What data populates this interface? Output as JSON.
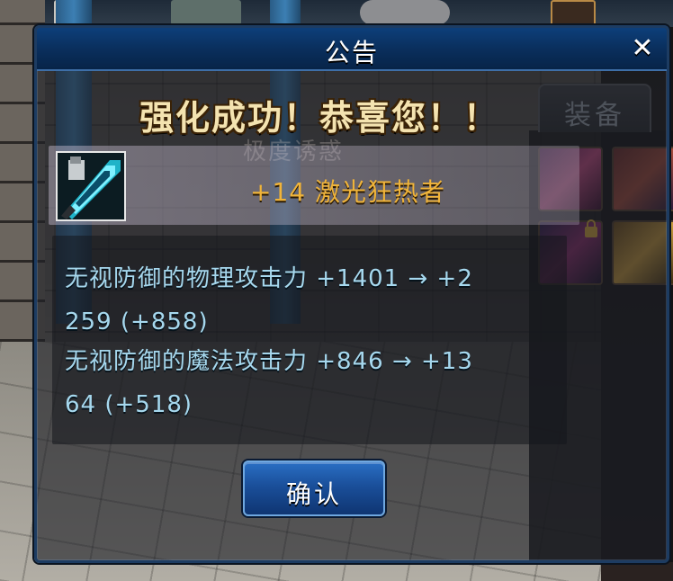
{
  "dialog": {
    "title": "公告",
    "close_icon": "close-icon",
    "close_glyph": "✕",
    "banner": "强化成功！恭喜您！！",
    "background_text": "极度诱惑",
    "item": {
      "icon": "weapon-icon",
      "name": "+14 激光狂热者"
    },
    "stats": [
      "无视防御的物理攻击力 +1401 → +2",
      "259 (+858)",
      "无视防御的魔法攻击力 +846 → +13",
      "64 (+518)"
    ],
    "confirm_label": "确认"
  },
  "side_panel": {
    "tab_label": "装备",
    "lock_icon": "lock-icon"
  },
  "colors": {
    "title_bar": "#0a2f5d",
    "item_name": "#f0b43a",
    "stat_text": "#a6d8ee",
    "banner_text": "#f4e3b0",
    "confirm_button": "#1a4f9a"
  }
}
